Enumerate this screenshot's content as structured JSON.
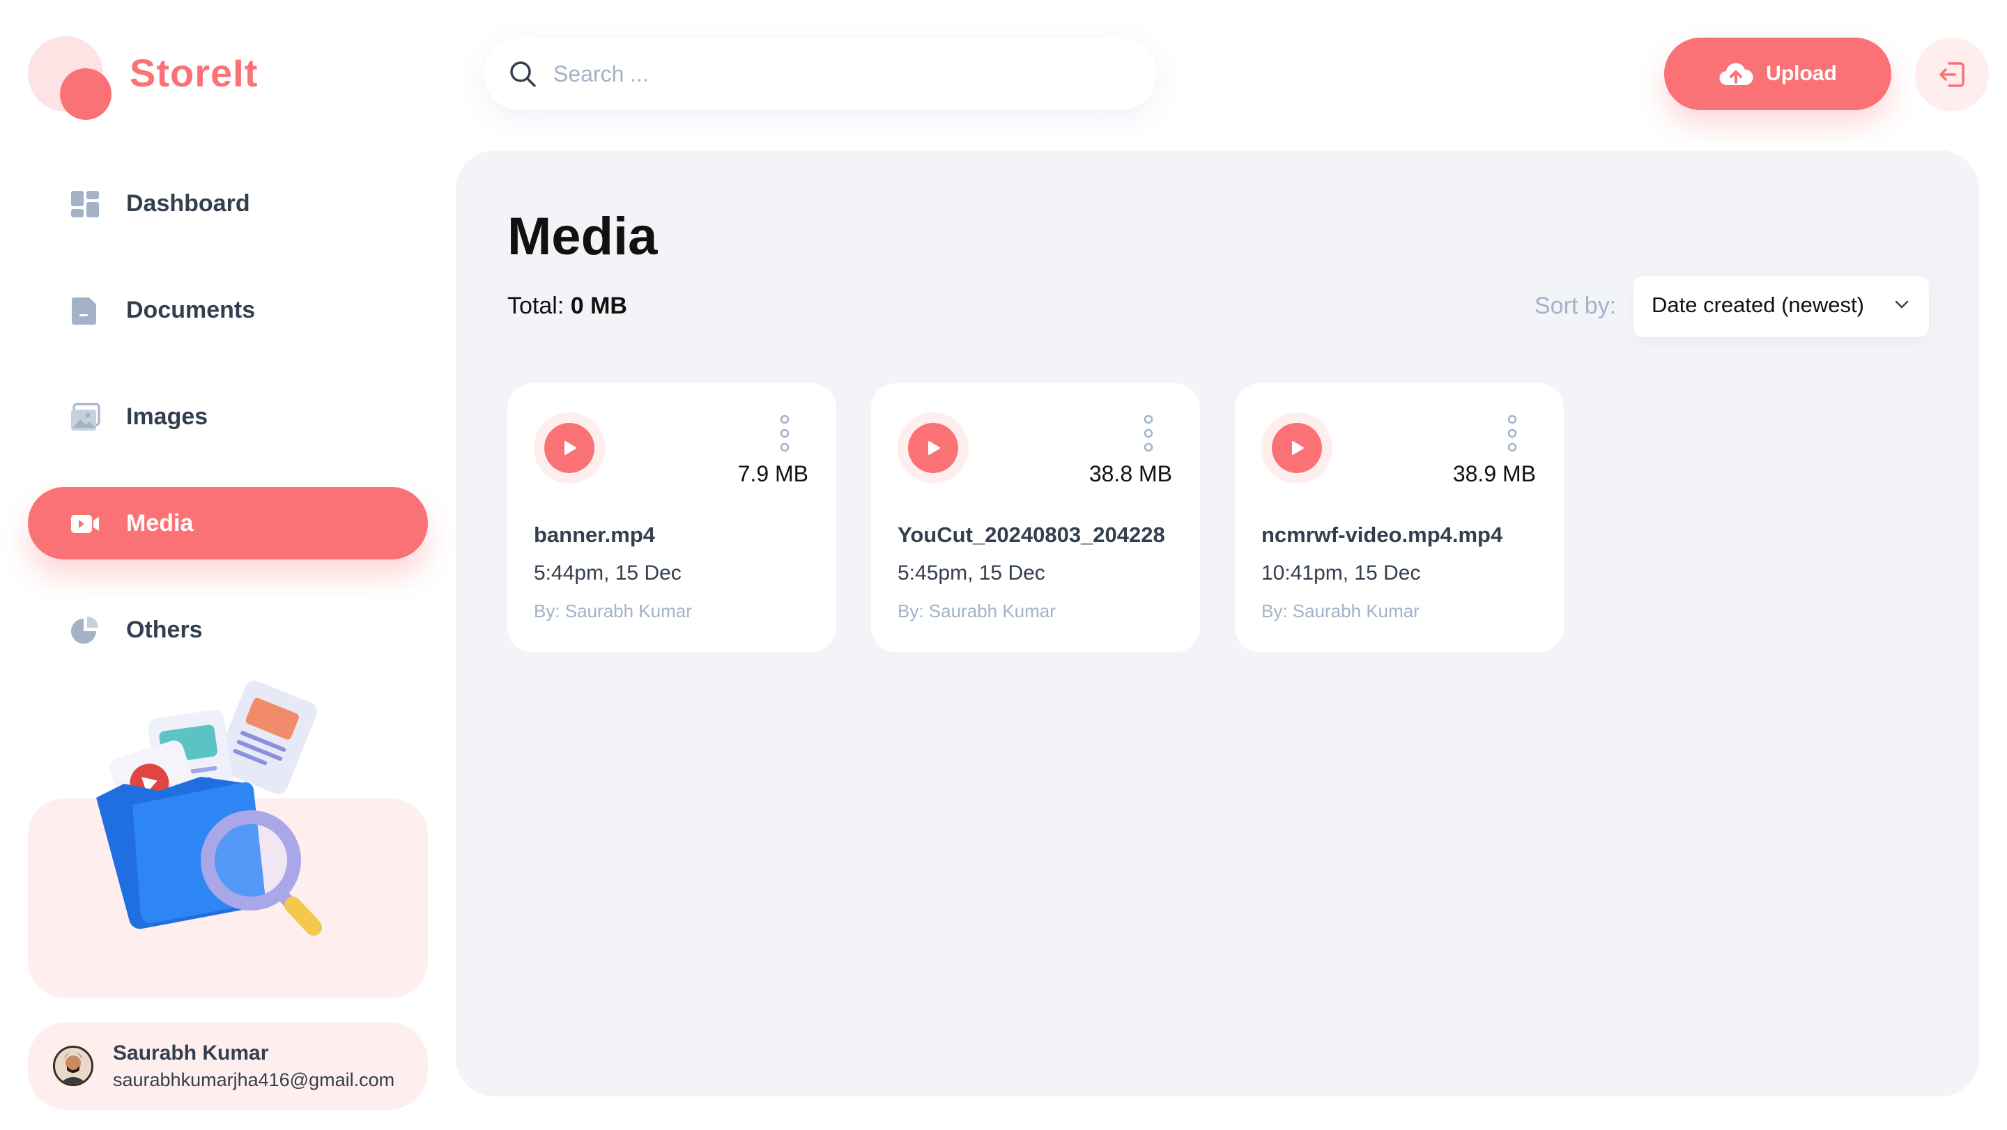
{
  "app": {
    "name": "StoreIt"
  },
  "sidebar": {
    "items": [
      {
        "label": "Dashboard",
        "icon": "dashboard-icon",
        "active": false
      },
      {
        "label": "Documents",
        "icon": "documents-icon",
        "active": false
      },
      {
        "label": "Images",
        "icon": "images-icon",
        "active": false
      },
      {
        "label": "Media",
        "icon": "media-icon",
        "active": true
      },
      {
        "label": "Others",
        "icon": "others-icon",
        "active": false
      }
    ]
  },
  "user": {
    "name": "Saurabh Kumar",
    "email": "saurabhkumarjha416@gmail.com"
  },
  "search": {
    "placeholder": "Search ...",
    "value": ""
  },
  "header": {
    "upload_label": "Upload"
  },
  "page": {
    "title": "Media",
    "total_label": "Total:",
    "total_value": "0 MB",
    "sort_label": "Sort by:",
    "sort_value": "Date created (newest)"
  },
  "files": [
    {
      "name": "banner.mp4",
      "size": "7.9 MB",
      "date": "5:44pm, 15 Dec",
      "owner": "By: Saurabh Kumar"
    },
    {
      "name": "YouCut_20240803_204228",
      "size": "38.8 MB",
      "date": "5:45pm, 15 Dec",
      "owner": "By: Saurabh Kumar"
    },
    {
      "name": "ncmrwf-video.mp4.mp4",
      "size": "38.9 MB",
      "date": "10:41pm, 15 Dec",
      "owner": "By: Saurabh Kumar"
    }
  ],
  "colors": {
    "brand": "#FA7275",
    "brand_light": "#FEEEEE",
    "panel": "#F2F4F8",
    "muted": "#A3B2C7",
    "text": "#333F4E"
  }
}
